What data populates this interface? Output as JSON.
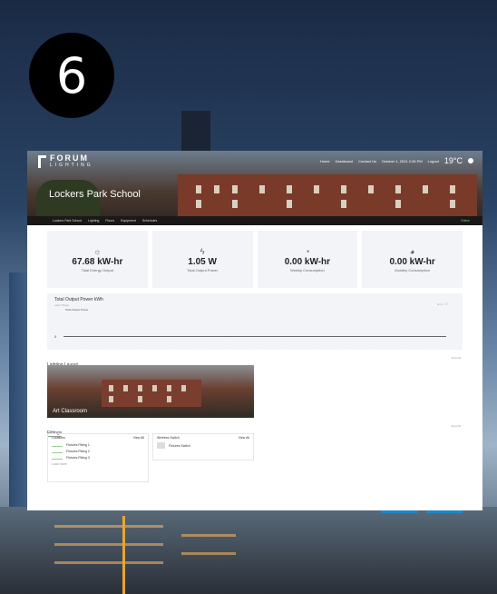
{
  "step_number": "6",
  "header": {
    "logo_word": "FORUM",
    "logo_sub": "LIGHTING",
    "nav": [
      "Home",
      "Dashboard",
      "Contact Us"
    ],
    "date": "October 1, 2021 2:26 PM",
    "logout": "Logout",
    "temperature": "19°C"
  },
  "page_title": "Lockers Park School",
  "subnav": {
    "items": [
      "Lockers Park School",
      "Lighting",
      "Floors",
      "Equipment",
      "Schedules"
    ],
    "status": "Online"
  },
  "stats": [
    {
      "icon": "bulb-icon",
      "glyph": "☼",
      "value": "67.68 kW-hr",
      "label": "Total Energy Output"
    },
    {
      "icon": "bolt-icon",
      "glyph": "ϟ",
      "value": "1.05 W",
      "label": "Total Output Power"
    },
    {
      "icon": "pie-icon",
      "glyph": "◔",
      "value": "0.00 kW-hr",
      "label": "Weekly Consumption"
    },
    {
      "icon": "pie-icon",
      "glyph": "◕",
      "value": "0.00 kW-hr",
      "label": "Monthly Consumption"
    }
  ],
  "chart": {
    "title": "Total Output Power kWh",
    "subtitle": "Last 7 Days",
    "legend": "Total Output Power",
    "y_tick": "0"
  },
  "lighting_layout": {
    "title": "Lighting Layout",
    "view_all": "View All",
    "room_caption": "Art Classroom"
  },
  "fittings": {
    "title": "Fittings",
    "view_all": "View All",
    "locations": {
      "title": "Locations",
      "view": "View All",
      "rows": [
        "Fixtures Fitting 1",
        "Fixtures Fitting 2",
        "Fixtures Fitting 3"
      ],
      "footer": "Load more"
    },
    "wireless": {
      "title": "Wireless Switch",
      "view": "View All",
      "row": "Fixtures Switch"
    }
  }
}
